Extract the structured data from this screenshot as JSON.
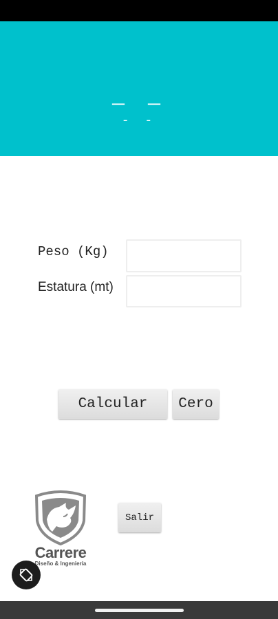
{
  "header": {
    "line1": "— —",
    "line2": "- -",
    "background": "#00c1cc"
  },
  "form": {
    "peso_label": "Peso (Kg)",
    "peso_value": "",
    "estatura_label": "Estatura (mt)",
    "estatura_value": ""
  },
  "buttons": {
    "calcular": "Calcular",
    "cero": "Cero",
    "salir": "Salir"
  },
  "logo": {
    "brand": "Carrere",
    "tagline": "Diseño & Ingeniería"
  },
  "icons": {
    "logo_emblem": "rhino-shield-icon",
    "rotate": "screen-rotate-icon"
  }
}
